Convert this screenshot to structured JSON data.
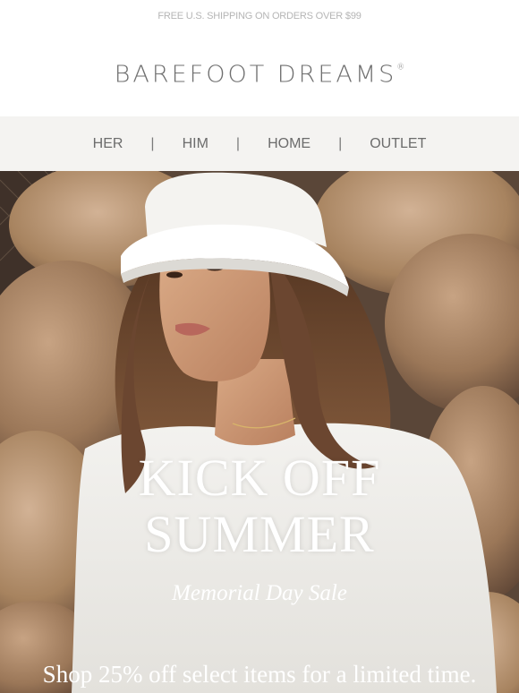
{
  "promo_bar": {
    "text": "FREE U.S. SHIPPING ON ORDERS OVER $99"
  },
  "brand": {
    "name": "BAREFOOT DREAMS",
    "mark": "®"
  },
  "nav": {
    "items": [
      {
        "label": "HER"
      },
      {
        "label": "HIM"
      },
      {
        "label": "HOME"
      },
      {
        "label": "OUTLET"
      }
    ],
    "separator": "|"
  },
  "hero": {
    "title_line1": "KICK OFF",
    "title_line2": "SUMMER",
    "subtitle": "Memorial Day Sale",
    "note": "Shop 25% off select items for a limited time."
  },
  "colors": {
    "nav_bg": "#f4f3f1",
    "text_gray": "#6c6c6c",
    "rock": "#9b7b62",
    "hat": "#f2f1ee"
  }
}
